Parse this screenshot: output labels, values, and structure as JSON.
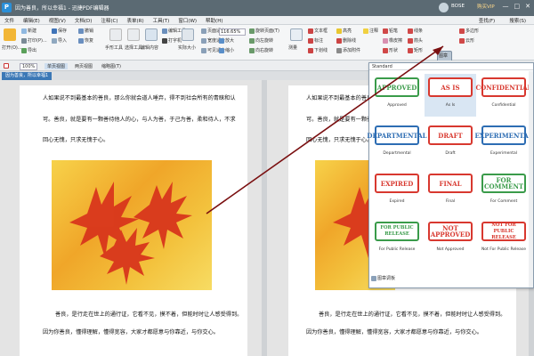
{
  "titlebar": {
    "app_title": "因为善良，所以幸福1 - 迅捷PDF编辑器",
    "user": "BOSE",
    "vip": "购买VIP",
    "login": "登录"
  },
  "menubar": {
    "items": [
      "文件",
      "编辑(E)",
      "视图(V)",
      "文档(D)",
      "注释(C)",
      "表单(R)",
      "工具(T)",
      "窗口(W)",
      "帮助(H)"
    ],
    "right": [
      "查找(F)",
      "搜索(S)"
    ]
  },
  "ribbon": {
    "open": "打开(O)...",
    "new": "新建",
    "print": "打印(P)...",
    "import": "导入",
    "export": "导出",
    "save": "保存",
    "undo": "撤销",
    "redo": "恢复",
    "select": "手形工具",
    "select2": "选择工具",
    "edit": "编辑内容",
    "edit_tool": "编辑工具",
    "zoom_value": "116.65%",
    "zoom_in": "放大",
    "zoom_out": "缩小",
    "fit_page": "页面适合",
    "fit_width": "宽度适合",
    "fit_visible": "可见适合",
    "actual": "实际大小",
    "rotate": "旋转页面(T)",
    "rotate_left": "向左旋转",
    "rotate_right": "向右旋转",
    "typewriter": "打字机",
    "textbox": "文本框",
    "callout": "标注",
    "highlight": "高亮",
    "strikeout": "删除线",
    "underline": "下划线",
    "note": "注释",
    "sticky": "添加附件",
    "stamp": "图章",
    "measure": "测量",
    "pencil": "铅笔",
    "eraser": "橡皮擦",
    "shapes": "形状",
    "line": "线条",
    "arrow": "箭头",
    "rect": "矩形",
    "polygon": "多边形",
    "cloud": "云形"
  },
  "toolbar2": {
    "zoom": "100%",
    "page_view": "单页视图",
    "two_page": "两页视图",
    "thumb": "缩略图(T)"
  },
  "tab": {
    "label": "因为善良，所以幸福1"
  },
  "document": {
    "para1_line1": "人如果说不到最基本的善良，那么你就会道人唾弃，得不到社会所有的青睐和认",
    "para1_line2": "可。善良，就是要有一颗善待他人的心，与人为善，于己为善，柔和待人，不求",
    "para1_line3": "回心无愧，只求无愧于心。",
    "para2_line1": "善良，是行走在世上的通行证，它看不见，摸不着，但能时时让人感受得到。",
    "para2_line2": "因为你善良，懂得理解，懂得宽容，大家才都愿意与你靠近，与你交心。"
  },
  "stamp_panel": {
    "header": "Standard",
    "footer": "图章调板",
    "stamps": [
      {
        "text": "APPROVED",
        "label": "Approved",
        "color": "#3a9b4a"
      },
      {
        "text": "AS IS",
        "label": "As Is",
        "color": "#d8382f"
      },
      {
        "text": "CONFIDENTIAL",
        "label": "Confidential",
        "color": "#d8382f"
      },
      {
        "text": "DEPARTMENTAL",
        "label": "Departmental",
        "color": "#2d6db3"
      },
      {
        "text": "DRAFT",
        "label": "Draft",
        "color": "#d8382f"
      },
      {
        "text": "EXPERIMENTAL",
        "label": "Experimental",
        "color": "#2d6db3"
      },
      {
        "text": "EXPIRED",
        "label": "Expired",
        "color": "#d8382f"
      },
      {
        "text": "FINAL",
        "label": "Final",
        "color": "#d8382f"
      },
      {
        "text": "FOR COMMENT",
        "label": "For Comment",
        "color": "#3a9b4a"
      },
      {
        "text": "FOR PUBLIC RELEASE",
        "label": "For Public Release",
        "color": "#3a9b4a"
      },
      {
        "text": "NOT APPROVED",
        "label": "Not Approved",
        "color": "#d8382f"
      },
      {
        "text": "NOT FOR PUBLIC RELEASE",
        "label": "Not For Public Release",
        "color": "#d8382f"
      }
    ]
  },
  "colors": {
    "arrow": "#7a0f10",
    "titlebar": "#5b6a73",
    "tab_active": "#3b78b6"
  }
}
